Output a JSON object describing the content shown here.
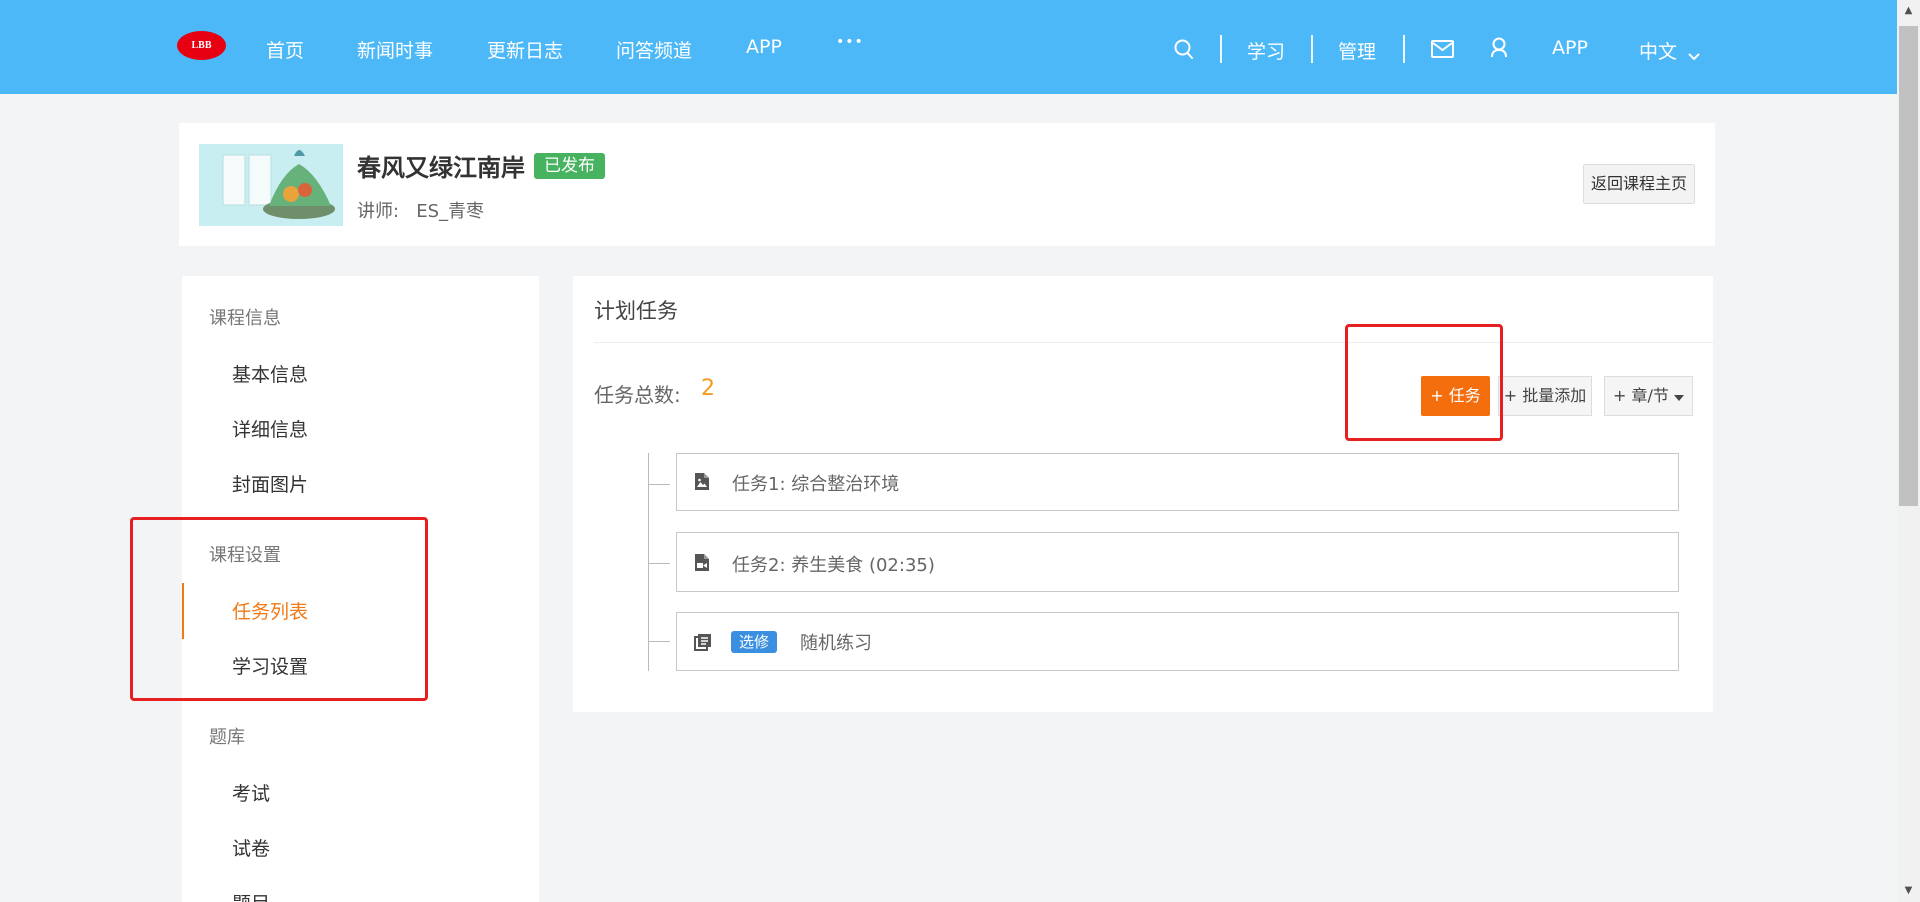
{
  "header": {
    "logo_text": "LBB",
    "nav": [
      "首页",
      "新闻时事",
      "更新日志",
      "问答频道",
      "APP",
      "•••"
    ],
    "right": {
      "learn": "学习",
      "manage": "管理",
      "app": "APP",
      "language": "中文"
    },
    "icons": [
      "search-icon",
      "mail-icon",
      "user-icon",
      "chevron-down-icon"
    ]
  },
  "course": {
    "title": "春风又绿江南岸",
    "status": "已发布",
    "teacher_label": "讲师:",
    "teacher_name": "ES_青枣",
    "back_button": "返回课程主页"
  },
  "sidebar": {
    "groups": [
      {
        "label": "课程信息",
        "items": [
          "基本信息",
          "详细信息",
          "封面图片"
        ]
      },
      {
        "label": "课程设置",
        "items": [
          "任务列表",
          "学习设置"
        ]
      },
      {
        "label": "题库",
        "items": [
          "考试",
          "试卷",
          "题目"
        ]
      }
    ],
    "active_item": "任务列表"
  },
  "main": {
    "title": "计划任务",
    "task_count_label": "任务总数:",
    "task_count": "2",
    "buttons": {
      "add_task": "+ 任务",
      "batch_add": "+ 批量添加",
      "chapter": "+ 章/节"
    },
    "tasks": [
      {
        "icon": "image-file-icon",
        "text": "任务1:  综合整治环境"
      },
      {
        "icon": "video-file-icon",
        "text": "任务2:  养生美食    (02:35)"
      },
      {
        "icon": "exercise-icon",
        "badge": "选修",
        "text": "随机练习"
      }
    ]
  },
  "colors": {
    "header_bg": "#4db8f8",
    "accent_orange": "#f46e0d",
    "active_text": "#f07a16",
    "published_green": "#47b25f",
    "optional_blue": "#3b8fe0",
    "annotation_red": "#e62020"
  }
}
